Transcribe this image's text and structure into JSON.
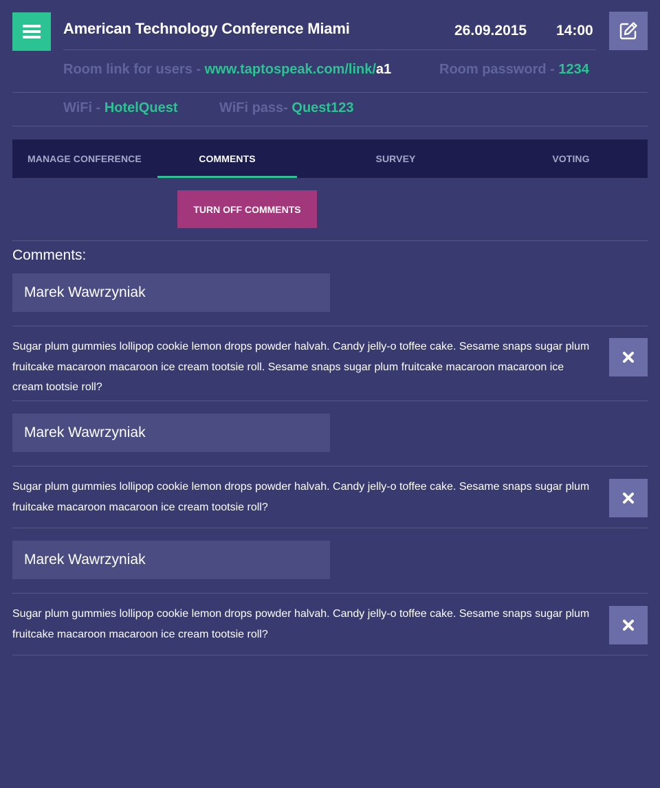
{
  "header": {
    "menu_icon": "hamburger-menu-icon",
    "title": "American Technology Conference Miami",
    "date": "26.09.2015",
    "time": "14:00",
    "edit_icon": "edit-pencil-icon",
    "room_link_label": "Room link for users - ",
    "room_link_url": "www.taptospeak.com/link/",
    "room_link_code": "a1",
    "room_password_label": "Room password - ",
    "room_password_value": "1234",
    "wifi_label": "WiFi - ",
    "wifi_value": "HotelQuest",
    "wifi_pass_label": "WiFi pass- ",
    "wifi_pass_value": "Quest123"
  },
  "tabs": [
    {
      "label": "MANAGE CONFERENCE",
      "active": false
    },
    {
      "label": "COMMENTS",
      "active": true
    },
    {
      "label": "SURVEY",
      "active": false
    },
    {
      "label": "VOTING",
      "active": false
    }
  ],
  "toggle_button_label": "TURN OFF COMMENTS",
  "comments_heading": "Comments:",
  "comments": [
    {
      "author": "Marek Wawrzyniak",
      "text": "Sugar plum gummies lollipop cookie lemon drops powder halvah. Candy jelly-o toffee cake. Sesame snaps sugar plum fruitcake macaroon macaroon ice cream tootsie roll. Sesame snaps sugar plum fruitcake macaroon macaroon ice cream tootsie roll?",
      "delete_icon": "close-icon"
    },
    {
      "author": "Marek Wawrzyniak",
      "text": "Sugar plum gummies lollipop cookie lemon drops powder halvah. Candy jelly-o toffee cake. Sesame snaps sugar plum fruitcake macaroon macaroon ice cream tootsie roll?",
      "delete_icon": "close-icon"
    },
    {
      "author": "Marek Wawrzyniak",
      "text": "Sugar plum gummies lollipop cookie lemon drops powder halvah. Candy jelly-o toffee cake. Sesame snaps sugar plum fruitcake macaroon macaroon ice cream tootsie roll?",
      "delete_icon": "close-icon"
    }
  ],
  "colors": {
    "background": "#393a70",
    "accent": "#2cc392",
    "muted_text": "#61649b",
    "tab_bar": "#1c1c4e",
    "toggle_button": "#a3377b",
    "author_box": "#4b4c82",
    "icon_button": "#6b6da8"
  }
}
